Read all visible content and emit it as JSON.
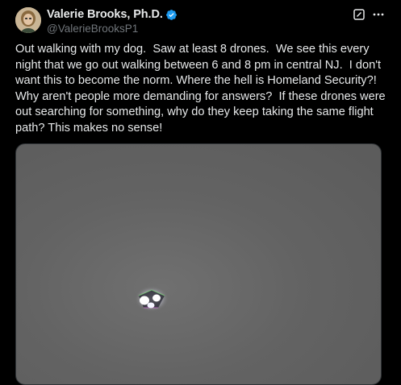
{
  "post": {
    "author": {
      "display_name": "Valerie Brooks, Ph.D.",
      "handle": "@ValerieBrooksP1",
      "verified": true,
      "verified_color": "#1d9bf0"
    },
    "icons": {
      "avatar": "avatar",
      "verified": "verified-badge-icon",
      "grok": "grok-icon",
      "more": "more-options-icon"
    },
    "text": "Out walking with my dog.  Saw at least 8 drones.  We see this every night that we go out walking between 6 and 8 pm in central NJ.  I don't want this to become the norm. Where the hell is Homeland Security?! Why aren't people more demanding for answers?  If these drones were out searching for something, why do they keep taking the same flight path? This makes no sense!",
    "media": {
      "type": "photo",
      "background_color": "#636363"
    }
  }
}
